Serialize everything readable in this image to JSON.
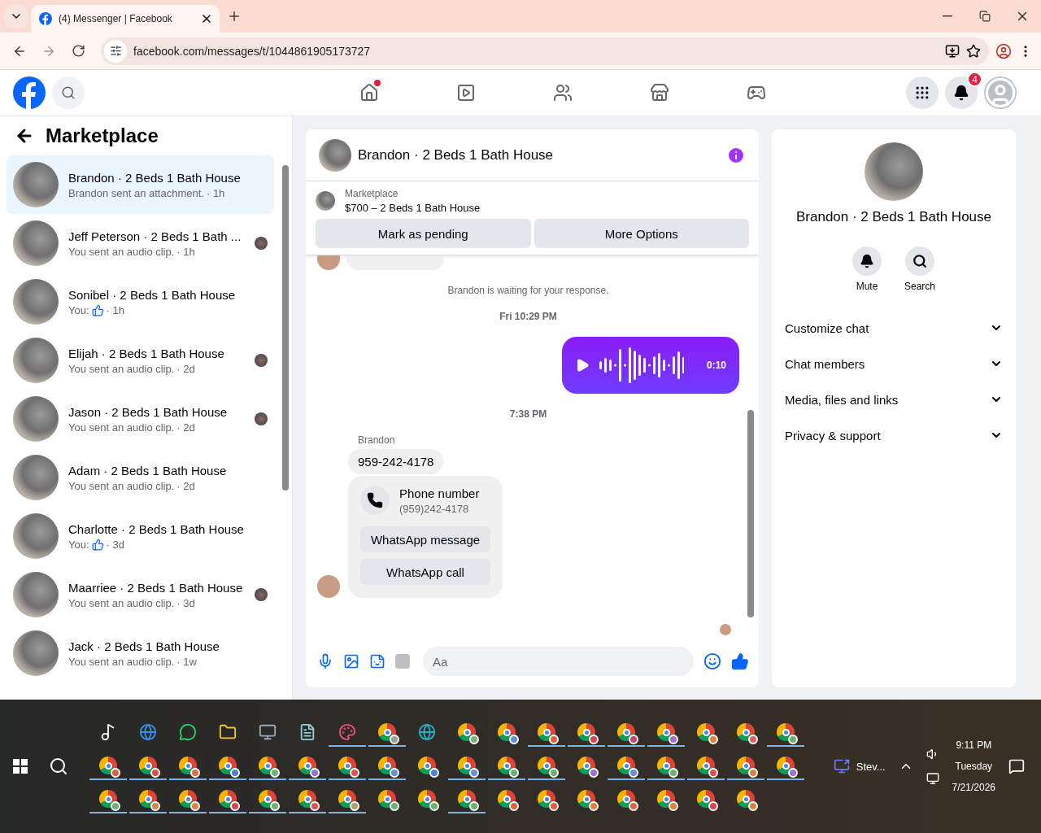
{
  "browser": {
    "tab_title": "(4) Messenger | Facebook",
    "url": "facebook.com/messages/t/1044861905173727"
  },
  "header": {
    "nav": [
      {
        "kind": "home",
        "dot": true
      },
      {
        "kind": "video",
        "dot": false
      },
      {
        "kind": "friends",
        "dot": false
      },
      {
        "kind": "market",
        "dot": false
      },
      {
        "kind": "games",
        "dot": false
      }
    ],
    "notifications": "4"
  },
  "sidebar": {
    "title": "Marketplace",
    "conversations": [
      {
        "name": "Brandon · 2 Beds 1 Bath House",
        "preview": "Brandon sent an attachment.",
        "meta": "· 1h",
        "like": false,
        "selected": true,
        "seen": false
      },
      {
        "name": "Jeff Peterson · 2 Beds 1 Bath ...",
        "preview": "You sent an audio clip.",
        "meta": "· 1h",
        "like": false,
        "selected": false,
        "seen": true
      },
      {
        "name": "Sonibel · 2 Beds 1 Bath House",
        "preview": "You:",
        "meta": "· 1h",
        "like": true,
        "selected": false,
        "seen": false
      },
      {
        "name": "Elijah · 2 Beds 1 Bath House",
        "preview": "You sent an audio clip.",
        "meta": "· 2d",
        "like": false,
        "selected": false,
        "seen": true
      },
      {
        "name": "Jason · 2 Beds 1 Bath House",
        "preview": "You sent an audio clip.",
        "meta": "· 2d",
        "like": false,
        "selected": false,
        "seen": true
      },
      {
        "name": "Adam · 2 Beds 1 Bath House",
        "preview": "You sent an audio clip.",
        "meta": "· 2d",
        "like": false,
        "selected": false,
        "seen": false
      },
      {
        "name": "Charlotte · 2 Beds 1 Bath House",
        "preview": "You:",
        "meta": "· 3d",
        "like": true,
        "selected": false,
        "seen": false
      },
      {
        "name": "Maarriee · 2 Beds 1 Bath House",
        "preview": "You sent an audio clip.",
        "meta": "· 3d",
        "like": false,
        "selected": false,
        "seen": true
      },
      {
        "name": "Jack · 2 Beds 1 Bath House",
        "preview": "You sent an audio clip.",
        "meta": "· 1w",
        "like": false,
        "selected": false,
        "seen": false
      }
    ]
  },
  "chat": {
    "title": "Brandon · 2 Beds 1 Bath House",
    "listing": {
      "source": "Marketplace",
      "title": "$700 – 2 Beds 1 Bath House"
    },
    "actions": [
      "Mark as pending",
      "More Options"
    ],
    "messages": [
      {
        "kind": "partial"
      },
      {
        "kind": "note",
        "text": "Brandon is waiting for your response."
      },
      {
        "kind": "timestamp",
        "text": "Fri 10:29 PM"
      },
      {
        "kind": "audio",
        "text": "0:10"
      },
      {
        "kind": "timestamp",
        "text": "7:38 PM"
      },
      {
        "kind": "sender",
        "text": "Brandon"
      },
      {
        "kind": "text",
        "text": "959-242-4178"
      },
      {
        "kind": "contact",
        "title": "Phone number",
        "text": "(959)242-4178",
        "buttons": [
          "WhatsApp message",
          "WhatsApp call"
        ]
      }
    ],
    "composer": {
      "placeholder": "Aa"
    }
  },
  "details": {
    "name": "Brandon · 2 Beds 1 Bath House",
    "actions": [
      {
        "kind": "mute",
        "label": "Mute"
      },
      {
        "kind": "search",
        "label": "Search"
      }
    ],
    "sections": [
      "Customize chat",
      "Chat members",
      "Media, files and links",
      "Privacy & support"
    ]
  },
  "taskbar": {
    "rows": [
      [
        {
          "kind": "tiktok",
          "running": false
        },
        {
          "kind": "globe",
          "running": false
        },
        {
          "kind": "whatsapp",
          "running": false
        },
        {
          "kind": "folder",
          "running": false
        },
        {
          "kind": "computer",
          "running": false
        },
        {
          "kind": "notepad",
          "running": false
        },
        {
          "kind": "paint",
          "running": true
        },
        {
          "kind": "chrome",
          "color": "#9e9e9e",
          "running": true
        },
        {
          "kind": "edge",
          "running": false
        },
        {
          "kind": "chrome",
          "color": "#7cb07c",
          "running": false
        },
        {
          "kind": "chrome",
          "color": "#6b8fd6",
          "running": false
        },
        {
          "kind": "chrome",
          "color": "#e06040",
          "running": true
        },
        {
          "kind": "chrome",
          "color": "#e04050",
          "running": true
        },
        {
          "kind": "chrome",
          "color": "#d04070",
          "running": true
        },
        {
          "kind": "chrome",
          "color": "#a070d0",
          "running": true
        },
        {
          "kind": "chrome",
          "color": "#e08040",
          "running": false
        },
        {
          "kind": "chrome",
          "color": "#e06060",
          "running": false
        },
        {
          "kind": "chrome",
          "color": "#70b070",
          "running": true
        }
      ],
      [
        {
          "kind": "chrome",
          "color": "#e06040",
          "running": true
        },
        {
          "kind": "chrome",
          "color": "#e05040",
          "running": true
        },
        {
          "kind": "chrome",
          "color": "#e07040",
          "running": true
        },
        {
          "kind": "chrome",
          "color": "#5080d0",
          "running": true
        },
        {
          "kind": "chrome",
          "color": "#70b070",
          "running": true
        },
        {
          "kind": "chrome",
          "color": "#a070d0",
          "running": true
        },
        {
          "kind": "chrome",
          "color": "#e05050",
          "running": true
        },
        {
          "kind": "chrome",
          "color": "#6b8fd6",
          "running": true
        },
        {
          "kind": "chrome",
          "color": "#5080d0",
          "running": false
        },
        {
          "kind": "chrome",
          "color": "#6b8fd6",
          "running": true
        },
        {
          "kind": "chrome",
          "color": "#70b070",
          "running": true
        },
        {
          "kind": "chrome",
          "color": "#70b070",
          "running": true
        },
        {
          "kind": "chrome",
          "color": "#a070d0",
          "running": false
        },
        {
          "kind": "chrome",
          "color": "#6b8fd6",
          "running": true
        },
        {
          "kind": "chrome",
          "color": "#70b070",
          "running": true
        },
        {
          "kind": "chrome",
          "color": "#e05050",
          "running": true
        },
        {
          "kind": "chrome",
          "color": "#e08040",
          "running": true
        },
        {
          "kind": "chrome",
          "color": "#a070d0",
          "running": true
        }
      ],
      [
        {
          "kind": "chrome",
          "color": "#70b070",
          "running": true
        },
        {
          "kind": "chrome",
          "color": "#e08040",
          "running": true
        },
        {
          "kind": "chrome",
          "color": "#e08040",
          "running": true
        },
        {
          "kind": "chrome",
          "color": "#e04050",
          "running": true
        },
        {
          "kind": "chrome",
          "color": "#70b070",
          "running": true
        },
        {
          "kind": "chrome",
          "color": "#e05050",
          "running": true
        },
        {
          "kind": "chrome",
          "color": "#b0a070",
          "running": true
        },
        {
          "kind": "chrome",
          "color": "#70b070",
          "running": false
        },
        {
          "kind": "chrome",
          "color": "#70b070",
          "running": false
        },
        {
          "kind": "chrome",
          "color": "#70b070",
          "running": true
        },
        {
          "kind": "chrome",
          "color": "#e06040",
          "running": false
        },
        {
          "kind": "chrome",
          "color": "#e06040",
          "running": false
        },
        {
          "kind": "chrome",
          "color": "#e08040",
          "running": false
        },
        {
          "kind": "chrome",
          "color": "#e06040",
          "running": false
        },
        {
          "kind": "chrome",
          "color": "#e08040",
          "running": false
        },
        {
          "kind": "chrome",
          "color": "#e04050",
          "running": false
        },
        {
          "kind": "chrome",
          "color": "#e08040",
          "running": false
        }
      ]
    ],
    "window_label": "Stev...",
    "time": "9:11 PM",
    "day": "Tuesday",
    "date": "7/21/2026"
  }
}
